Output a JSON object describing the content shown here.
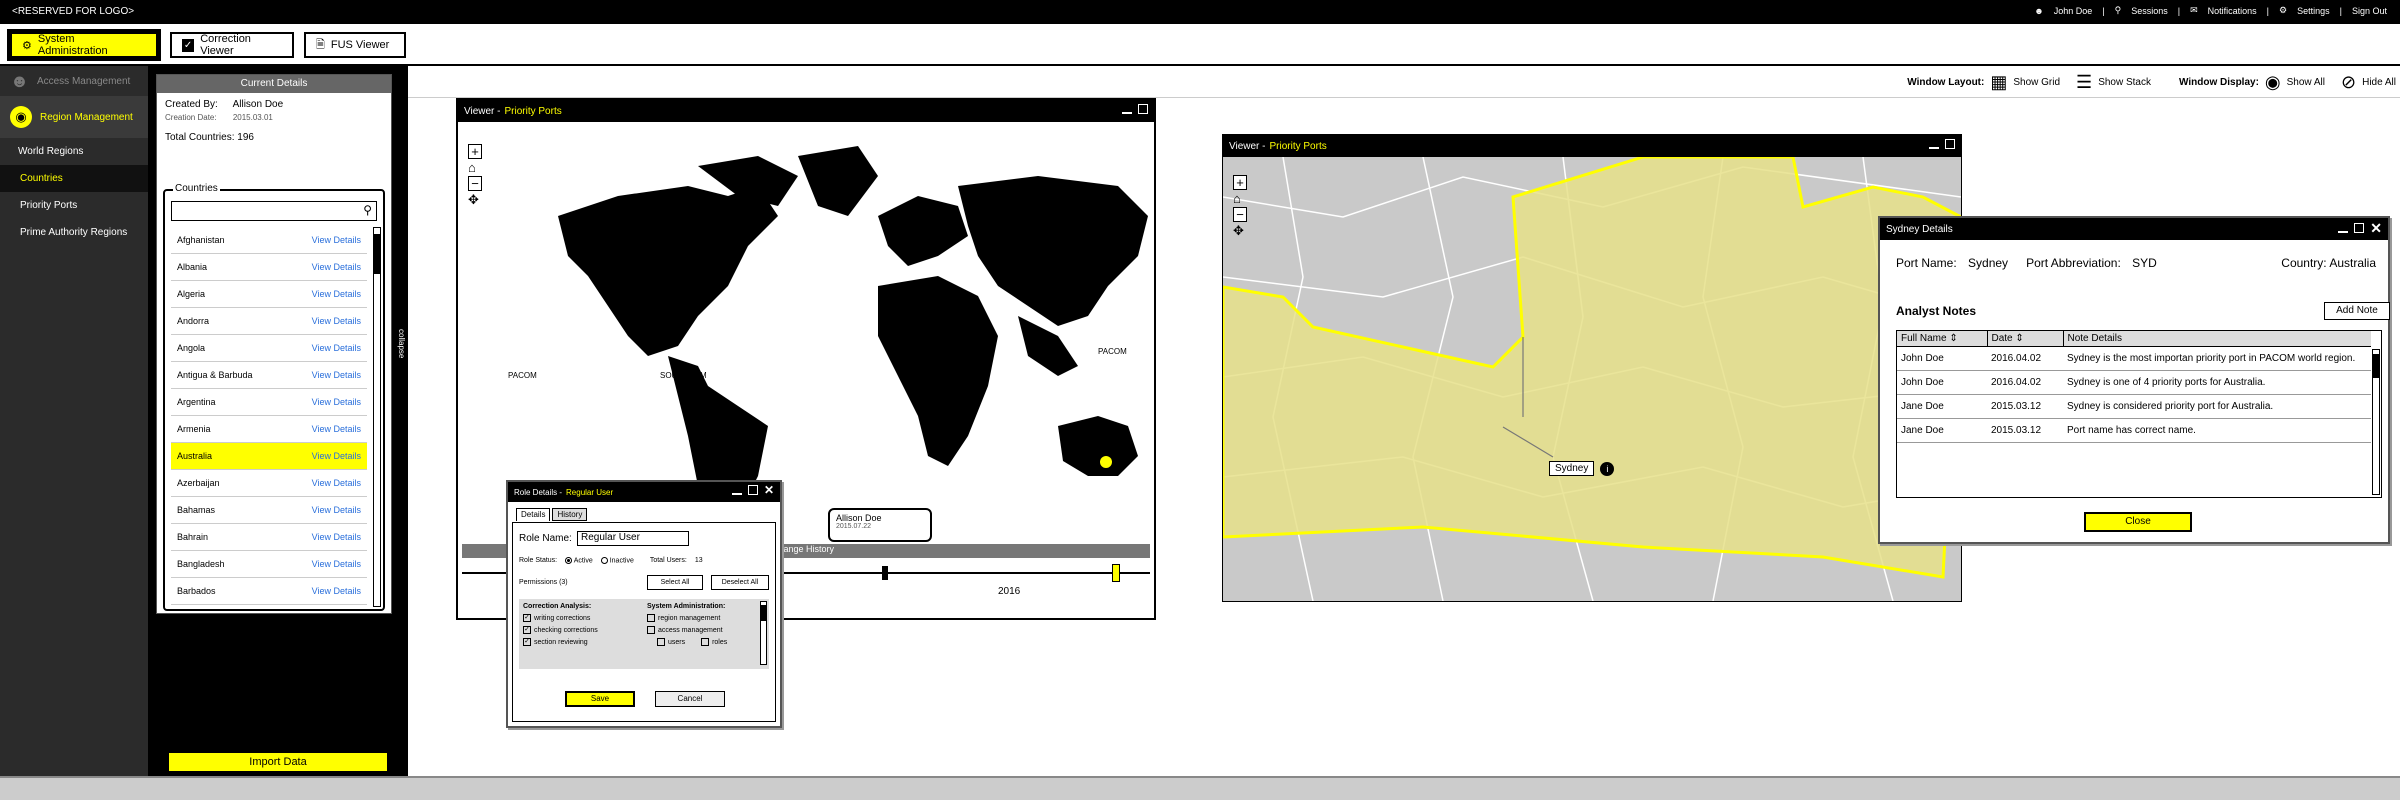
{
  "topbar": {
    "logo": "<RESERVED FOR LOGO>",
    "user": "John Doe",
    "sessions": "Sessions",
    "notifications": "Notifications",
    "settings": "Settings",
    "signout": "Sign Out"
  },
  "tabs": [
    {
      "label": "System Administration"
    },
    {
      "label": "Correction Viewer"
    },
    {
      "label": "FUS Viewer"
    }
  ],
  "nav": {
    "access": "Access Management",
    "region": "Region Management",
    "items": [
      "World Regions",
      "Countries",
      "Priority Ports",
      "Prime Authority Regions"
    ]
  },
  "details": {
    "header": "Current Details",
    "created_by_label": "Created By:",
    "created_by": "Allison Doe",
    "creation_date_label": "Creation Date:",
    "creation_date": "2015.03.01",
    "total_label": "Total Countries:",
    "total": "196",
    "countries_legend": "Countries",
    "view_label": "View Details",
    "countries": [
      "Afghanistan",
      "Albania",
      "Algeria",
      "Andorra",
      "Angola",
      "Antigua & Barbuda",
      "Argentina",
      "Armenia",
      "Australia",
      "Azerbaijan",
      "Bahamas",
      "Bahrain",
      "Bangladesh",
      "Barbados"
    ],
    "collapse": "collapse",
    "import": "Import Data"
  },
  "toolstrip": {
    "layout_label": "Window Layout:",
    "show_grid": "Show Grid",
    "show_stack": "Show Stack",
    "display_label": "Window Display:",
    "show_all": "Show All",
    "hide_all": "Hide All"
  },
  "viewer1": {
    "title": "Viewer -",
    "subtitle": "Priority Ports",
    "pacom1": "PACOM",
    "southcom": "SOUTHCOM",
    "pacom2": "PACOM",
    "history": "Change History",
    "year": "2016",
    "tip_name": "Allison Doe",
    "tip_date": "2015.07.22"
  },
  "viewer2": {
    "title": "Viewer -",
    "subtitle": "Priority Ports",
    "label": "Sydney"
  },
  "role": {
    "title": "Role Details -",
    "subtitle": "Regular User",
    "tab_details": "Details",
    "tab_history": "History",
    "name_label": "Role Name:",
    "name_value": "Regular User",
    "status_label": "Role Status:",
    "active": "Active",
    "inactive": "Inactive",
    "users_label": "Total Users:",
    "users_value": "13",
    "perm_label": "Permissions (3)",
    "select_all": "Select All",
    "deselect_all": "Deselect All",
    "ca_head": "Correction Analysis:",
    "ca": [
      "writing corrections",
      "checking corrections",
      "section reviewing"
    ],
    "sa_head": "System Administration:",
    "sa": [
      "region management",
      "access management"
    ],
    "sa_sub": [
      "users",
      "roles"
    ],
    "save": "Save",
    "cancel": "Cancel"
  },
  "sydney": {
    "title": "Sydney Details",
    "port_name_label": "Port Name:",
    "port_name": "Sydney",
    "abbr_label": "Port Abbreviation:",
    "abbr": "SYD",
    "country_label": "Country:",
    "country": "Australia",
    "notes": "Analyst Notes",
    "add_note": "Add Note",
    "cols": [
      "Full Name",
      "Date",
      "Note Details"
    ],
    "rows": [
      {
        "name": "John Doe",
        "date": "2016.04.02",
        "note": "Sydney is the most importan priority port in PACOM world region."
      },
      {
        "name": "John Doe",
        "date": "2016.04.02",
        "note": "Sydney is one of 4 priority ports for Australia."
      },
      {
        "name": "Jane Doe",
        "date": "2015.03.12",
        "note": "Sydney is considered priority port for Australia."
      },
      {
        "name": "Jane Doe",
        "date": "2015.03.12",
        "note": "Port name has correct name."
      }
    ],
    "close": "Close"
  }
}
